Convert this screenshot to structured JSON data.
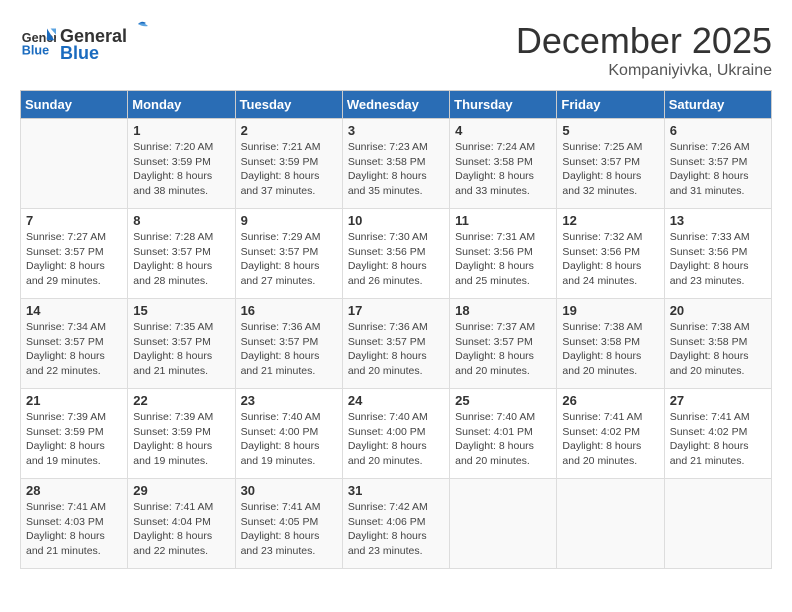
{
  "header": {
    "logo_line1": "General",
    "logo_line2": "Blue",
    "month": "December 2025",
    "location": "Kompaniyivka, Ukraine"
  },
  "days_of_week": [
    "Sunday",
    "Monday",
    "Tuesday",
    "Wednesday",
    "Thursday",
    "Friday",
    "Saturday"
  ],
  "weeks": [
    [
      {
        "day": "",
        "info": ""
      },
      {
        "day": "1",
        "info": "Sunrise: 7:20 AM\nSunset: 3:59 PM\nDaylight: 8 hours\nand 38 minutes."
      },
      {
        "day": "2",
        "info": "Sunrise: 7:21 AM\nSunset: 3:59 PM\nDaylight: 8 hours\nand 37 minutes."
      },
      {
        "day": "3",
        "info": "Sunrise: 7:23 AM\nSunset: 3:58 PM\nDaylight: 8 hours\nand 35 minutes."
      },
      {
        "day": "4",
        "info": "Sunrise: 7:24 AM\nSunset: 3:58 PM\nDaylight: 8 hours\nand 33 minutes."
      },
      {
        "day": "5",
        "info": "Sunrise: 7:25 AM\nSunset: 3:57 PM\nDaylight: 8 hours\nand 32 minutes."
      },
      {
        "day": "6",
        "info": "Sunrise: 7:26 AM\nSunset: 3:57 PM\nDaylight: 8 hours\nand 31 minutes."
      }
    ],
    [
      {
        "day": "7",
        "info": "Sunrise: 7:27 AM\nSunset: 3:57 PM\nDaylight: 8 hours\nand 29 minutes."
      },
      {
        "day": "8",
        "info": "Sunrise: 7:28 AM\nSunset: 3:57 PM\nDaylight: 8 hours\nand 28 minutes."
      },
      {
        "day": "9",
        "info": "Sunrise: 7:29 AM\nSunset: 3:57 PM\nDaylight: 8 hours\nand 27 minutes."
      },
      {
        "day": "10",
        "info": "Sunrise: 7:30 AM\nSunset: 3:56 PM\nDaylight: 8 hours\nand 26 minutes."
      },
      {
        "day": "11",
        "info": "Sunrise: 7:31 AM\nSunset: 3:56 PM\nDaylight: 8 hours\nand 25 minutes."
      },
      {
        "day": "12",
        "info": "Sunrise: 7:32 AM\nSunset: 3:56 PM\nDaylight: 8 hours\nand 24 minutes."
      },
      {
        "day": "13",
        "info": "Sunrise: 7:33 AM\nSunset: 3:56 PM\nDaylight: 8 hours\nand 23 minutes."
      }
    ],
    [
      {
        "day": "14",
        "info": "Sunrise: 7:34 AM\nSunset: 3:57 PM\nDaylight: 8 hours\nand 22 minutes."
      },
      {
        "day": "15",
        "info": "Sunrise: 7:35 AM\nSunset: 3:57 PM\nDaylight: 8 hours\nand 21 minutes."
      },
      {
        "day": "16",
        "info": "Sunrise: 7:36 AM\nSunset: 3:57 PM\nDaylight: 8 hours\nand 21 minutes."
      },
      {
        "day": "17",
        "info": "Sunrise: 7:36 AM\nSunset: 3:57 PM\nDaylight: 8 hours\nand 20 minutes."
      },
      {
        "day": "18",
        "info": "Sunrise: 7:37 AM\nSunset: 3:57 PM\nDaylight: 8 hours\nand 20 minutes."
      },
      {
        "day": "19",
        "info": "Sunrise: 7:38 AM\nSunset: 3:58 PM\nDaylight: 8 hours\nand 20 minutes."
      },
      {
        "day": "20",
        "info": "Sunrise: 7:38 AM\nSunset: 3:58 PM\nDaylight: 8 hours\nand 20 minutes."
      }
    ],
    [
      {
        "day": "21",
        "info": "Sunrise: 7:39 AM\nSunset: 3:59 PM\nDaylight: 8 hours\nand 19 minutes."
      },
      {
        "day": "22",
        "info": "Sunrise: 7:39 AM\nSunset: 3:59 PM\nDaylight: 8 hours\nand 19 minutes."
      },
      {
        "day": "23",
        "info": "Sunrise: 7:40 AM\nSunset: 4:00 PM\nDaylight: 8 hours\nand 19 minutes."
      },
      {
        "day": "24",
        "info": "Sunrise: 7:40 AM\nSunset: 4:00 PM\nDaylight: 8 hours\nand 20 minutes."
      },
      {
        "day": "25",
        "info": "Sunrise: 7:40 AM\nSunset: 4:01 PM\nDaylight: 8 hours\nand 20 minutes."
      },
      {
        "day": "26",
        "info": "Sunrise: 7:41 AM\nSunset: 4:02 PM\nDaylight: 8 hours\nand 20 minutes."
      },
      {
        "day": "27",
        "info": "Sunrise: 7:41 AM\nSunset: 4:02 PM\nDaylight: 8 hours\nand 21 minutes."
      }
    ],
    [
      {
        "day": "28",
        "info": "Sunrise: 7:41 AM\nSunset: 4:03 PM\nDaylight: 8 hours\nand 21 minutes."
      },
      {
        "day": "29",
        "info": "Sunrise: 7:41 AM\nSunset: 4:04 PM\nDaylight: 8 hours\nand 22 minutes."
      },
      {
        "day": "30",
        "info": "Sunrise: 7:41 AM\nSunset: 4:05 PM\nDaylight: 8 hours\nand 23 minutes."
      },
      {
        "day": "31",
        "info": "Sunrise: 7:42 AM\nSunset: 4:06 PM\nDaylight: 8 hours\nand 23 minutes."
      },
      {
        "day": "",
        "info": ""
      },
      {
        "day": "",
        "info": ""
      },
      {
        "day": "",
        "info": ""
      }
    ]
  ]
}
